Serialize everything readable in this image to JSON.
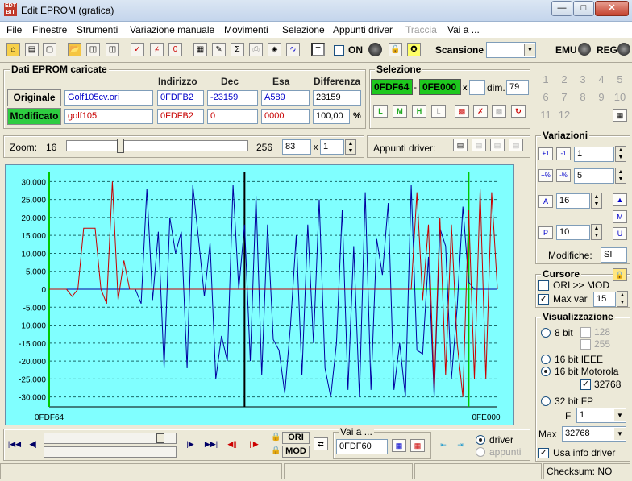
{
  "window": {
    "title": "Edit EPROM (grafica)",
    "app_icon_text": "EDT BIT"
  },
  "menu": [
    "File",
    "Finestre",
    "Strumenti",
    "Variazione manuale",
    "Movimenti",
    "Selezione",
    "Appunti driver",
    "Traccia",
    "Vai a ..."
  ],
  "toolbar": {
    "on_label": "ON",
    "scansione_label": "Scansione",
    "emu_label": "EMU",
    "reg_label": "REG"
  },
  "dati": {
    "title": "Dati EPROM caricate",
    "col_indirizzo": "Indirizzo",
    "col_dec": "Dec",
    "col_esa": "Esa",
    "col_diff": "Differenza",
    "originale_label": "Originale",
    "modificato_label": "Modificato",
    "ori_file": "Golf105cv.ori",
    "ori_addr": "0FDFB2",
    "ori_dec": "-23159",
    "ori_esa": "A589",
    "ori_diff": "23159",
    "mod_file": "golf105",
    "mod_addr": "0FDFB2",
    "mod_dec": "0",
    "mod_esa": "0000",
    "mod_diff": "100,00",
    "pct": "%"
  },
  "selezione": {
    "title": "Selezione",
    "from": "0FDF64",
    "dash": "-",
    "to": "0FE000",
    "x": "x",
    "dim_label": "dim.",
    "dim": "79"
  },
  "numgrid": [
    "1",
    "2",
    "3",
    "4",
    "5",
    "6",
    "7",
    "8",
    "9",
    "10",
    "11",
    "12"
  ],
  "zoom": {
    "label": "Zoom:",
    "min": "16",
    "max": "256",
    "value": "83",
    "x": "x",
    "mult": "1",
    "level": 0.29
  },
  "appunti_label": "Appunti driver:",
  "variazioni": {
    "title": "Variazioni",
    "v1": "1",
    "v2": "5",
    "v3": "16",
    "v4": "10",
    "modifiche_label": "Modifiche:",
    "modifiche": "SI"
  },
  "cursore": {
    "title": "Cursore",
    "ori_mod": "ORI >> MOD",
    "maxvar_label": "Max var",
    "maxvar": "15"
  },
  "visualizzazione": {
    "title": "Visualizzazione",
    "bit8": "8 bit",
    "v128": "128",
    "v255": "255",
    "ieee": "16 bit IEEE",
    "motorola": "16 bit Motorola",
    "v32768": "32768",
    "fp32": "32 bit FP",
    "f_label": "F",
    "f_value": "1",
    "max_label": "Max",
    "max_value": "32768",
    "usa_info": "Usa info driver"
  },
  "bottom": {
    "ori": "ORI",
    "mod": "MOD",
    "vai_title": "Vai a ...",
    "vai_value": "0FDF60",
    "driver": "driver",
    "appunti": "appunti"
  },
  "status": {
    "checksum": "Checksum: NO"
  },
  "colors": {
    "chart_bg": "#80ffff",
    "original": "#0000a0",
    "modified": "#c80000",
    "marker": "#00c800"
  },
  "chart_data": {
    "type": "line",
    "xlabel_left": "0FDF64",
    "xlabel_right": "0FE000",
    "yticks": [
      "30.000",
      "25.000",
      "20.000",
      "15.000",
      "10.000",
      "5.000",
      "0",
      "-5.000",
      "-10.000",
      "-15.000",
      "-20.000",
      "-25.000",
      "-30.000"
    ],
    "ylim": [
      -32768,
      32768
    ],
    "n": 79,
    "markers": [
      0,
      34,
      73
    ],
    "grid": "horizontal dashed",
    "series": [
      {
        "values": [
          0,
          0,
          0,
          0,
          0,
          0,
          0,
          0,
          0,
          0,
          0,
          0,
          0,
          0,
          0,
          0,
          -4000,
          28000,
          -3000,
          16000,
          -22000,
          20000,
          10000,
          16000,
          -22000,
          29000,
          14000,
          -2000,
          13000,
          -25000,
          -13000,
          -20000,
          29000,
          0,
          18000,
          -20000,
          26000,
          -24000,
          18000,
          -14000,
          -17000,
          -29000,
          -10000,
          15000,
          -24000,
          18000,
          -15000,
          25000,
          -22000,
          -30000,
          -15000,
          22000,
          -28000,
          12000,
          -30000,
          27000,
          -28000,
          14000,
          4000,
          24000,
          -28000,
          -15000,
          -30000,
          29000,
          -17000,
          -18000,
          9000,
          -30000,
          17000,
          12000,
          -25000,
          -5000,
          23000,
          2000,
          0,
          0,
          0,
          0,
          0
        ]
      },
      {
        "values": [
          0,
          0,
          0,
          0,
          -2000,
          0,
          17000,
          17000,
          17000,
          0,
          -4000,
          30000,
          -3000,
          8000,
          0,
          0,
          0,
          0,
          0,
          0,
          0,
          0,
          0,
          0,
          0,
          0,
          0,
          0,
          0,
          0,
          0,
          0,
          0,
          0,
          0,
          0,
          0,
          0,
          0,
          0,
          0,
          0,
          0,
          0,
          0,
          0,
          0,
          0,
          0,
          0,
          0,
          0,
          0,
          0,
          0,
          0,
          0,
          0,
          0,
          0,
          0,
          0,
          0,
          0,
          27000,
          -3000,
          18000,
          -28000,
          20000,
          -24000,
          18000,
          -15000,
          -30000,
          22000,
          -25000,
          28000,
          -25000,
          27000,
          0
        ]
      }
    ]
  }
}
